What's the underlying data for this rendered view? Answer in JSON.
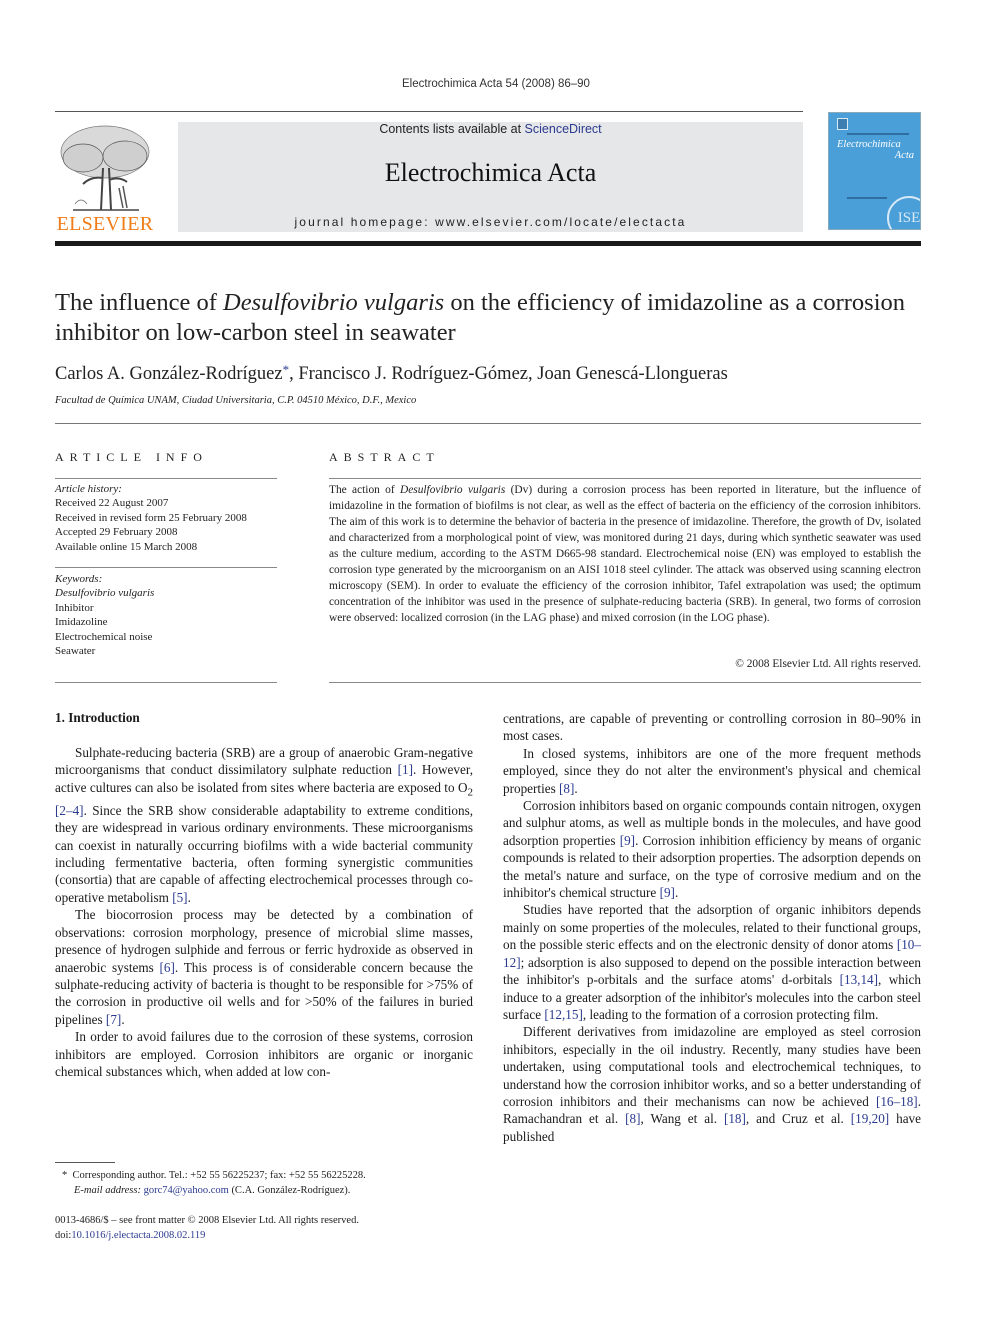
{
  "running_head": "Electrochimica Acta 54 (2008) 86–90",
  "header": {
    "publisher_logo_word": "ELSEVIER",
    "contents_prefix": "Contents lists available at ",
    "contents_link": "ScienceDirect",
    "journal_name": "Electrochimica Acta",
    "homepage_line": "journal homepage: www.elsevier.com/locate/electacta",
    "cover": {
      "title_line1": "Electrochimica",
      "title_line2": "Acta",
      "society_badge": "ISE"
    },
    "colors": {
      "elsevier_orange": "#f07d1a",
      "banner_gray": "#e6e7e8",
      "cover_blue": "#4b9fd8",
      "link_blue": "#2b3a8f"
    }
  },
  "article": {
    "title_part1": "The influence of ",
    "title_italic": "Desulfovibrio vulgaris",
    "title_part2": " on the efficiency of imidazoline as a corrosion inhibitor on low-carbon steel in seawater",
    "authors": [
      {
        "name": "Carlos A. González-Rodríguez",
        "mark": "*"
      },
      {
        "name": "Francisco J. Rodríguez-Gómez",
        "mark": ""
      },
      {
        "name": "Joan Genescá-Llongueras",
        "mark": ""
      }
    ],
    "affiliation": "Facultad de Química UNAM, Ciudad Universitaria, C.P. 04510 México, D.F., Mexico"
  },
  "article_info": {
    "heading": "ARTICLE INFO",
    "history_label": "Article history:",
    "history": [
      "Received 22 August 2007",
      "Received in revised form 25 February 2008",
      "Accepted 29 February 2008",
      "Available online 15 March 2008"
    ],
    "keywords_label": "Keywords:",
    "keywords": [
      "Desulfovibrio vulgaris",
      "Inhibitor",
      "Imidazoline",
      "Electrochemical noise",
      "Seawater"
    ]
  },
  "abstract": {
    "heading": "ABSTRACT",
    "lead": "The action of ",
    "lead_italic": "Desulfovibrio vulgaris",
    "body": " (Dv) during a corrosion process has been reported in literature, but the influence of imidazoline in the formation of biofilms is not clear, as well as the effect of bacteria on the efficiency of the corrosion inhibitors. The aim of this work is to determine the behavior of bacteria in the presence of imidazoline. Therefore, the growth of Dv, isolated and characterized from a morphological point of view, was monitored during 21 days, during which synthetic seawater was used as the culture medium, according to the ASTM D665-98 standard. Electrochemical noise (EN) was employed to establish the corrosion type generated by the microorganism on an AISI 1018 steel cylinder. The attack was observed using scanning electron microscopy (SEM). In order to evaluate the efficiency of the corrosion inhibitor, Tafel extrapolation was used; the optimum concentration of the inhibitor was used in the presence of sulphate-reducing bacteria (SRB). In general, two forms of corrosion were observed: localized corrosion (in the LAG phase) and mixed corrosion (in the LOG phase).",
    "copyright": "© 2008 Elsevier Ltd. All rights reserved."
  },
  "introduction": {
    "heading": "1.  Introduction",
    "p1": [
      {
        "t": "Sulphate-reducing bacteria (SRB) are a group of anaerobic Gram-negative microorganisms that conduct dissimilatory sulphate reduction "
      },
      {
        "ref": "[1]"
      },
      {
        "t": ". However, active cultures can also be isolated from sites where bacteria are exposed to O"
      },
      {
        "sub": "2"
      },
      {
        "t": " "
      },
      {
        "ref": "[2–4]"
      },
      {
        "t": ". Since the SRB show considerable adaptability to extreme conditions, they are widespread in various ordinary environments. These microorganisms can coexist in naturally occurring biofilms with a wide bacterial community including fermentative bacteria, often forming synergistic communities (consortia) that are capable of affecting electrochemical processes through co-operative metabolism "
      },
      {
        "ref": "[5]"
      },
      {
        "t": "."
      }
    ],
    "p2": [
      {
        "t": "The biocorrosion process may be detected by a combination of observations: corrosion morphology, presence of microbial slime masses, presence of hydrogen sulphide and ferrous or ferric hydroxide as observed in anaerobic systems "
      },
      {
        "ref": "[6]"
      },
      {
        "t": ". This process is of considerable concern because the sulphate-reducing activity of bacteria is thought to be responsible for >75% of the corrosion in productive oil wells and for >50% of the failures in buried pipelines "
      },
      {
        "ref": "[7]"
      },
      {
        "t": "."
      }
    ],
    "p3": [
      {
        "t": "In order to avoid failures due to the corrosion of these systems, corrosion inhibitors are employed. Corrosion inhibitors are organic or inorganic chemical substances which, when added at low con-"
      }
    ],
    "r0": [
      {
        "t": "centrations, are capable of preventing or controlling corrosion in 80–90% in most cases."
      }
    ],
    "r1": [
      {
        "t": "In closed systems, inhibitors are one of the more frequent methods employed, since they do not alter the environment's physical and chemical properties "
      },
      {
        "ref": "[8]"
      },
      {
        "t": "."
      }
    ],
    "r2": [
      {
        "t": "Corrosion inhibitors based on organic compounds contain nitrogen, oxygen and sulphur atoms, as well as multiple bonds in the molecules, and have good adsorption properties "
      },
      {
        "ref": "[9]"
      },
      {
        "t": ". Corrosion inhibition efficiency by means of organic compounds is related to their adsorption properties. The adsorption depends on the metal's nature and surface, on the type of corrosive medium and on the inhibitor's chemical structure "
      },
      {
        "ref": "[9]"
      },
      {
        "t": "."
      }
    ],
    "r3": [
      {
        "t": "Studies have reported that the adsorption of organic inhibitors depends mainly on some properties of the molecules, related to their functional groups, on the possible steric effects and on the electronic density of donor atoms "
      },
      {
        "ref": "[10–12]"
      },
      {
        "t": "; adsorption is also supposed to depend on the possible interaction between the inhibitor's p-orbitals and the surface atoms' d-orbitals "
      },
      {
        "ref": "[13,14]"
      },
      {
        "t": ", which induce to a greater adsorption of the inhibitor's molecules into the carbon steel surface "
      },
      {
        "ref": "[12,15]"
      },
      {
        "t": ", leading to the formation of a corrosion protecting film."
      }
    ],
    "r4": [
      {
        "t": "Different derivatives from imidazoline are employed as steel corrosion inhibitors, especially in the oil industry. Recently, many studies have been undertaken, using computational tools and electrochemical techniques, to understand how the corrosion inhibitor works, and so a better understanding of corrosion inhibitors and their mechanisms can now be achieved "
      },
      {
        "ref": "[16–18]"
      },
      {
        "t": ". Ramachandran et al. "
      },
      {
        "ref": "[8]"
      },
      {
        "t": ", Wang et al. "
      },
      {
        "ref": "[18]"
      },
      {
        "t": ", and Cruz et al. "
      },
      {
        "ref": "[19,20]"
      },
      {
        "t": " have published"
      }
    ]
  },
  "footnote": {
    "mark": "*",
    "line1": "Corresponding author. Tel.: +52 55 56225237; fax: +52 55 56225228.",
    "email_label": "E-mail address: ",
    "email": "gorc74@yahoo.com",
    "email_suffix": " (C.A. González-Rodríguez)."
  },
  "front_matter": {
    "issn_line": "0013-4686/$ – see front matter © 2008 Elsevier Ltd. All rights reserved.",
    "doi_prefix": "doi:",
    "doi": "10.1016/j.electacta.2008.02.119"
  }
}
